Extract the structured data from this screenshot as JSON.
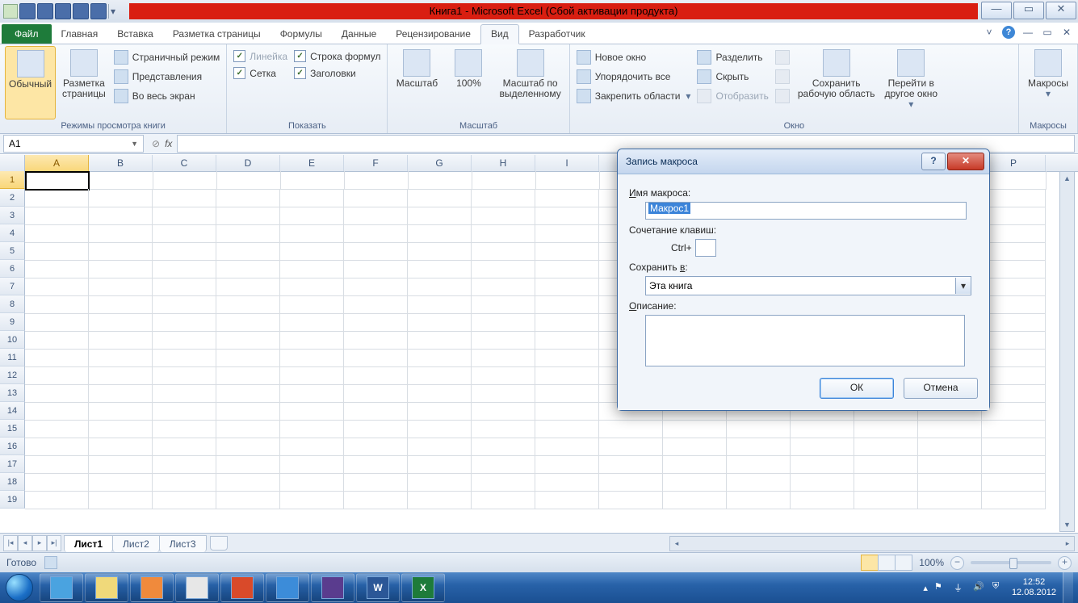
{
  "title": "Книга1 - Microsoft Excel (Сбой активации продукта)",
  "tabs": {
    "file": "Файл",
    "home": "Главная",
    "insert": "Вставка",
    "pagelayout": "Разметка страницы",
    "formulas": "Формулы",
    "data": "Данные",
    "review": "Рецензирование",
    "view": "Вид",
    "developer": "Разработчик"
  },
  "ribbon": {
    "views": {
      "normal": "Обычный",
      "pagelayout": "Разметка\nстраницы",
      "pagebreak": "Страничный режим",
      "custom": "Представления",
      "fullscreen": "Во весь экран",
      "group": "Режимы просмотра книги"
    },
    "show": {
      "ruler": "Линейка",
      "gridlines": "Сетка",
      "formulabar": "Строка формул",
      "headings": "Заголовки",
      "group": "Показать"
    },
    "zoom": {
      "zoom": "Масштаб",
      "hundred": "100%",
      "selection": "Масштаб по\nвыделенному",
      "group": "Масштаб"
    },
    "window": {
      "newwin": "Новое окно",
      "arrange": "Упорядочить все",
      "freeze": "Закрепить области",
      "split": "Разделить",
      "hide": "Скрыть",
      "unhide": "Отобразить",
      "savews": "Сохранить\nрабочую область",
      "switch": "Перейти в\nдругое окно",
      "group": "Окно"
    },
    "macros": {
      "macros": "Макросы",
      "group": "Макросы"
    }
  },
  "namebox": "A1",
  "columns": [
    "A",
    "B",
    "C",
    "D",
    "E",
    "F",
    "G",
    "H",
    "I",
    "",
    "",
    "",
    "",
    "",
    "",
    "P"
  ],
  "rows": [
    "1",
    "2",
    "3",
    "4",
    "5",
    "6",
    "7",
    "8",
    "9",
    "10",
    "11",
    "12",
    "13",
    "14",
    "15",
    "16",
    "17",
    "18",
    "19"
  ],
  "sheets": {
    "s1": "Лист1",
    "s2": "Лист2",
    "s3": "Лист3"
  },
  "status": {
    "ready": "Готово",
    "zoom": "100%"
  },
  "dialog": {
    "title": "Запись макроса",
    "name_label": "Имя макроса:",
    "name_value": "Макрос1",
    "shortcut_label": "Сочетание клавиш:",
    "shortcut_prefix": "Ctrl+",
    "store_label": "Сохранить в:",
    "store_value": "Эта книга",
    "desc_label": "Описание:",
    "ok": "ОК",
    "cancel": "Отмена"
  },
  "clock": {
    "time": "12:52",
    "date": "12.08.2012"
  }
}
